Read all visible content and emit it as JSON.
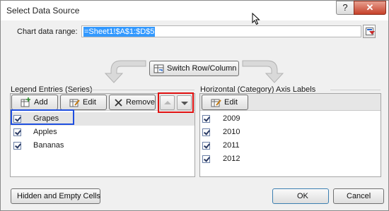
{
  "window": {
    "title": "Select Data Source",
    "help_label": "?",
    "close_label": "✕"
  },
  "range": {
    "label": "Chart data range:",
    "value": "=Sheet1!$A$1:$D$5"
  },
  "switch_button": {
    "label": "Switch Row/Column"
  },
  "legend_panel": {
    "label": "Legend Entries (Series)",
    "add_label": "Add",
    "edit_label": "Edit",
    "remove_label": "Remove",
    "items": [
      {
        "label": "Grapes",
        "checked": true,
        "selected": true
      },
      {
        "label": "Apples",
        "checked": true,
        "selected": false
      },
      {
        "label": "Bananas",
        "checked": true,
        "selected": false
      }
    ]
  },
  "axis_panel": {
    "label": "Horizontal (Category) Axis Labels",
    "edit_label": "Edit",
    "items": [
      {
        "label": "2009",
        "checked": true
      },
      {
        "label": "2010",
        "checked": true
      },
      {
        "label": "2011",
        "checked": true
      },
      {
        "label": "2012",
        "checked": true
      }
    ]
  },
  "footer": {
    "hidden_cells_label": "Hidden and Empty Cells",
    "ok_label": "OK",
    "cancel_label": "Cancel"
  },
  "colors": {
    "highlight_blue": "#1f4fe0",
    "highlight_red": "#e01010",
    "selection": "#3399ff"
  }
}
